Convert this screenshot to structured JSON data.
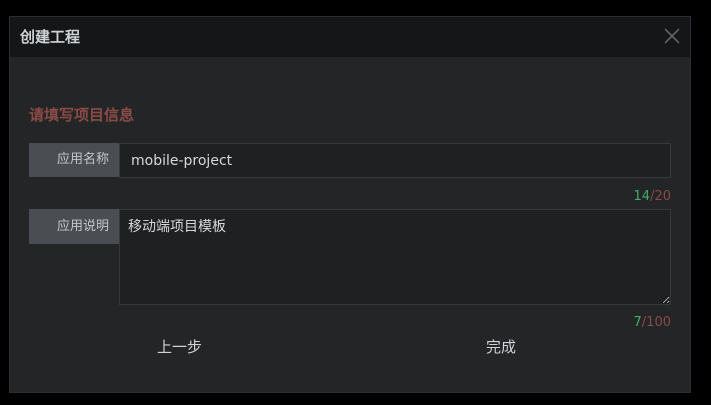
{
  "dialog": {
    "title": "创建工程",
    "close_icon": "close-icon"
  },
  "form": {
    "heading": "请填写项目信息",
    "name": {
      "label": "应用名称",
      "value": "mobile-project",
      "count": "14",
      "separator": "/",
      "max": "20"
    },
    "description": {
      "label": "应用说明",
      "value": "移动端项目模板",
      "count": "7",
      "separator": "/",
      "max": "100"
    }
  },
  "footer": {
    "prev_label": "上一步",
    "finish_label": "完成"
  },
  "colors": {
    "heading": "#8a4a46",
    "count_ok": "#3fae6a"
  }
}
